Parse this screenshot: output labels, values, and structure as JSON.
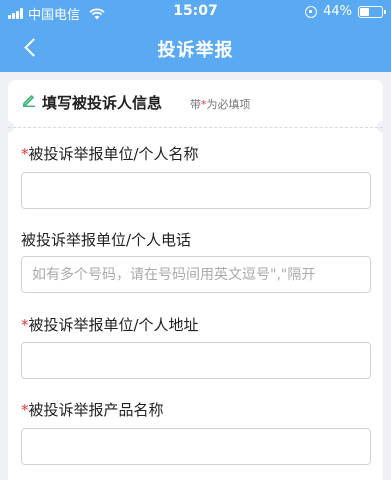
{
  "status_bar": {
    "carrier": "中国电信",
    "time": "15:07",
    "battery": "44%"
  },
  "nav": {
    "title": "投诉举报"
  },
  "section": {
    "title": "填写被投诉人信息",
    "required_hint_prefix": "带",
    "required_star": "*",
    "required_hint_suffix": "为必填项"
  },
  "fields": [
    {
      "label": "被投诉举报单位/个人名称",
      "required": true,
      "value": "",
      "placeholder": ""
    },
    {
      "label": "被投诉举报单位/个人电话",
      "required": false,
      "value": "",
      "placeholder": "如有多个号码，请在号码间用英文逗号\",\"隔开"
    },
    {
      "label": "被投诉举报单位/个人地址",
      "required": true,
      "value": "",
      "placeholder": ""
    },
    {
      "label": "被投诉举报产品名称",
      "required": true,
      "value": "",
      "placeholder": ""
    }
  ],
  "colors": {
    "header": "#5aa9f3",
    "required_star": "#e5393c",
    "background": "#eef1f5"
  }
}
